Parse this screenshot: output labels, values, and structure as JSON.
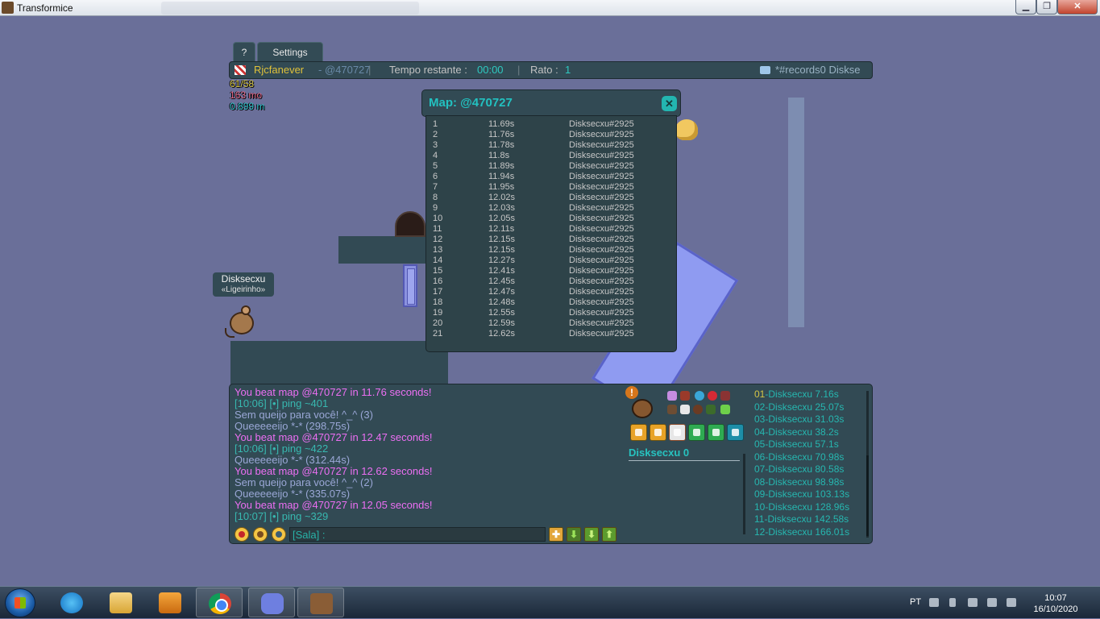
{
  "window": {
    "title": "Transformice",
    "min_symbol": "▁",
    "max_symbol": "❐",
    "close_symbol": "✕"
  },
  "tabs": {
    "help": "?",
    "settings": "Settings"
  },
  "topbar": {
    "author": "Rjcfanever",
    "map_code": "- @470727",
    "separator": "|",
    "time_label": "Tempo restante :",
    "time_value": "00:00",
    "mice_label": "Rato :",
    "mice_value": "1",
    "room": "*#records0 Diskse"
  },
  "stats": {
    "fps": "61/58",
    "memory": "163 mo",
    "size": "0.899 m"
  },
  "player": {
    "name": "Disksecxu",
    "title": "«Ligeirinho»"
  },
  "records_popup": {
    "title": "Map: @470727",
    "close_symbol": "✕",
    "rows": [
      {
        "rank": "1",
        "time": "11.69s",
        "player": "Disksecxu#2925"
      },
      {
        "rank": "2",
        "time": "11.76s",
        "player": "Disksecxu#2925"
      },
      {
        "rank": "3",
        "time": "11.78s",
        "player": "Disksecxu#2925"
      },
      {
        "rank": "4",
        "time": "11.8s",
        "player": "Disksecxu#2925"
      },
      {
        "rank": "5",
        "time": "11.89s",
        "player": "Disksecxu#2925"
      },
      {
        "rank": "6",
        "time": "11.94s",
        "player": "Disksecxu#2925"
      },
      {
        "rank": "7",
        "time": "11.95s",
        "player": "Disksecxu#2925"
      },
      {
        "rank": "8",
        "time": "12.02s",
        "player": "Disksecxu#2925"
      },
      {
        "rank": "9",
        "time": "12.03s",
        "player": "Disksecxu#2925"
      },
      {
        "rank": "10",
        "time": "12.05s",
        "player": "Disksecxu#2925"
      },
      {
        "rank": "11",
        "time": "12.11s",
        "player": "Disksecxu#2925"
      },
      {
        "rank": "12",
        "time": "12.15s",
        "player": "Disksecxu#2925"
      },
      {
        "rank": "13",
        "time": "12.15s",
        "player": "Disksecxu#2925"
      },
      {
        "rank": "14",
        "time": "12.27s",
        "player": "Disksecxu#2925"
      },
      {
        "rank": "15",
        "time": "12.41s",
        "player": "Disksecxu#2925"
      },
      {
        "rank": "16",
        "time": "12.45s",
        "player": "Disksecxu#2925"
      },
      {
        "rank": "17",
        "time": "12.47s",
        "player": "Disksecxu#2925"
      },
      {
        "rank": "18",
        "time": "12.48s",
        "player": "Disksecxu#2925"
      },
      {
        "rank": "19",
        "time": "12.55s",
        "player": "Disksecxu#2925"
      },
      {
        "rank": "20",
        "time": "12.59s",
        "player": "Disksecxu#2925"
      },
      {
        "rank": "21",
        "time": "12.62s",
        "player": "Disksecxu#2925"
      }
    ]
  },
  "chat": {
    "messages": [
      {
        "text": "You beat map @470727 in 11.76 seconds!",
        "color": "pink"
      },
      {
        "text": "[10:06] [•] ping ~401",
        "color": "teal"
      },
      {
        "text": "Sem queijo para você! ^_^ (3)",
        "color": "gray"
      },
      {
        "text": "Queeeeeijo *-* (298.75s)",
        "color": "gray"
      },
      {
        "text": "You beat map @470727 in 12.47 seconds!",
        "color": "pink"
      },
      {
        "text": "[10:06] [•] ping ~422",
        "color": "teal"
      },
      {
        "text": "Queeeeeijo *-* (312.44s)",
        "color": "gray"
      },
      {
        "text": "You beat map @470727 in 12.62 seconds!",
        "color": "pink"
      },
      {
        "text": "Sem queijo para você! ^_^ (2)",
        "color": "gray"
      },
      {
        "text": "Queeeeeijo *-* (335.07s)",
        "color": "gray"
      },
      {
        "text": "You beat map @470727 in 12.05 seconds!",
        "color": "pink"
      },
      {
        "text": "[10:07] [•] ping ~329",
        "color": "teal"
      }
    ],
    "input_value": "[Sala] :",
    "plus_symbol": "✚",
    "down_symbol": "⬇",
    "up_symbol": "⬆"
  },
  "profile": {
    "alert_symbol": "!",
    "score": "Disksecxu 0"
  },
  "leaderboard": [
    {
      "num": "01",
      "entry": "-Disksecxu 7.16s"
    },
    {
      "num": "02",
      "entry": "-Disksecxu 25.07s"
    },
    {
      "num": "03",
      "entry": "-Disksecxu 31.03s"
    },
    {
      "num": "04",
      "entry": "-Disksecxu 38.2s"
    },
    {
      "num": "05",
      "entry": "-Disksecxu 57.1s"
    },
    {
      "num": "06",
      "entry": "-Disksecxu 70.98s"
    },
    {
      "num": "07",
      "entry": "-Disksecxu 80.58s"
    },
    {
      "num": "08",
      "entry": "-Disksecxu 98.98s"
    },
    {
      "num": "09",
      "entry": "-Disksecxu 103.13s"
    },
    {
      "num": "10",
      "entry": "-Disksecxu 128.96s"
    },
    {
      "num": "11",
      "entry": "-Disksecxu 142.58s"
    },
    {
      "num": "12",
      "entry": "-Disksecxu 166.01s"
    }
  ],
  "taskbar": {
    "language": "PT",
    "time": "10:07",
    "date": "16/10/2020"
  },
  "colors": {
    "panel": "#324a54",
    "accent_teal": "#22c1c0",
    "pink": "#ec6ff3",
    "gold": "#d5c545"
  }
}
